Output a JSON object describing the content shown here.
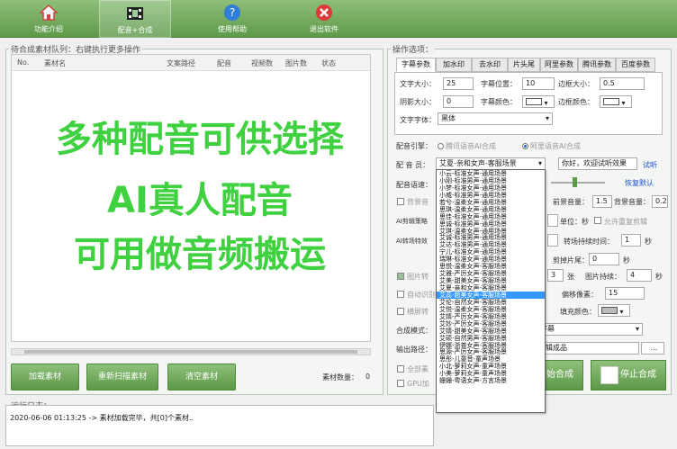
{
  "toolbar": {
    "items": [
      {
        "label": "功能介绍",
        "icon": "home-icon"
      },
      {
        "label": "配音+合成",
        "icon": "film-icon"
      },
      {
        "label": "使用帮助",
        "icon": "help-icon"
      },
      {
        "label": "退出软件",
        "icon": "close-icon"
      }
    ]
  },
  "queue": {
    "title": "待合成素材队列：右键执行更多操作",
    "columns": [
      "No.",
      "素材名",
      "文案路径",
      "配音",
      "视频数",
      "图片数",
      "状态"
    ],
    "buttons": {
      "load": "加载素材",
      "rescan": "重新扫描素材",
      "clear": "清空素材"
    },
    "count_label": "素材数量：",
    "count_value": "0"
  },
  "options": {
    "title": "操作选项：",
    "tabs": [
      "字幕参数",
      "加水印",
      "去水印",
      "片头尾",
      "阿里参数",
      "腾讯参数",
      "百度参数"
    ],
    "subtitle": {
      "font_size_label": "文字大小：",
      "font_size": "25",
      "position_label": "字幕位置：",
      "position": "10",
      "border_size_label": "边框大小：",
      "border_size": "0.5",
      "shadow_label": "阴影大小：",
      "shadow": "0",
      "color_label": "字幕颜色：",
      "border_color_label": "边框颜色：",
      "font_label": "文字字体：",
      "font": "黑体"
    },
    "engine_label": "配音引擎：",
    "engine_tencent": "腾讯语音AI合成",
    "engine_ali": "阿里语音AI合成",
    "voice_label": "配 音 员：",
    "voice_value": "艾夏-亲和女声-客服场景",
    "preview_text": "你好，欢迎试听效果",
    "preview_link": "试听",
    "speed_label": "配音语速：",
    "restore_default": "恢复默认",
    "bg_music": "背景音",
    "fg_volume_label": "前景音量：",
    "fg_volume": "1.5",
    "bg_volume_label": "背景音量：",
    "bg_volume": "0.2",
    "ai_strategy": "AI剪辑策略",
    "unit_label": "单位：秒",
    "allow_repeat": "允许重复剪辑",
    "ai_transition": "AI转场特效",
    "transition_time_label": "转场持续时间：",
    "transition_time": "1",
    "sec": "秒",
    "cut_tail_label": "剪掉片尾：",
    "cut_tail": "0",
    "image_check": "图片转",
    "image_count": "3",
    "image_unit": "张",
    "image_duration_label": "图片持续：",
    "image_duration": "4",
    "auto_label": "自动识别",
    "offset_label": "偏移像素：",
    "offset": "15",
    "horizontal": "横屏转",
    "fill_color_label": "填充颜色：",
    "mode_label": "合成模式：",
    "mode_value": "字幕",
    "output_label": "输出路径：",
    "output_value": "剪辑成品",
    "browse": "...",
    "all_label": "全部素",
    "gpu_label": "GPU加",
    "start": "开始合成",
    "stop": "停止合成"
  },
  "voices": [
    "小云-标准女声-通用场景",
    "小刚-标准男声-通用场景",
    "小梦-标准女声-通用场景",
    "小威-标准男声-通用场景",
    "若兮-温柔女声-通用场景",
    "思琪-温柔女声-通用场景",
    "思佳-标准女声-通用场景",
    "思诚-标准男声-通用场景",
    "艾琪-温柔女声-通用场景",
    "艾诚-标准男声-通用场景",
    "艾达-标准男声-通用场景",
    "宁儿-标准女声-通用场景",
    "瑞琳-标准女声-通用场景",
    "思悦-温柔女声-客服场景",
    "艾雅-严厉女声-客服场景",
    "艾美-甜美女声-客服场景",
    "艾夏-亲和女声-客服场景",
    "艾蕊-超美女声-客服场景",
    "艾伦-自然女声-客服场景",
    "艾悦-温柔女声-客服场景",
    "艾婧-严厉女声-客服场景",
    "艾妙-严厉女声-客服场景",
    "艾婧-甜美女声-客服场景",
    "艾硕-自然男声-客服场景",
    "伊娜-浙普女声-客服场景",
    "思源-严厉女声-客服场景",
    "思彤-儿童音-童声场景",
    "小北-萝莉女声-童声场景",
    "小美-萝莉女声-童声场景",
    "姗姗-粤语女声-方言场景"
  ],
  "voices_selected_index": 17,
  "overlay": {
    "line1": "多种配音可供选择",
    "line2": "AI真人配音",
    "line3": "可用做音频搬运"
  },
  "log": {
    "title": "运行日志：",
    "entry": "2020-06-06 01:13:25 -> 素材加载完毕，共[0]个素材.."
  },
  "colors": {
    "brand_green": "#5e9a4a",
    "overlay_green": "#3fd13f",
    "selection_blue": "#3399ff"
  }
}
